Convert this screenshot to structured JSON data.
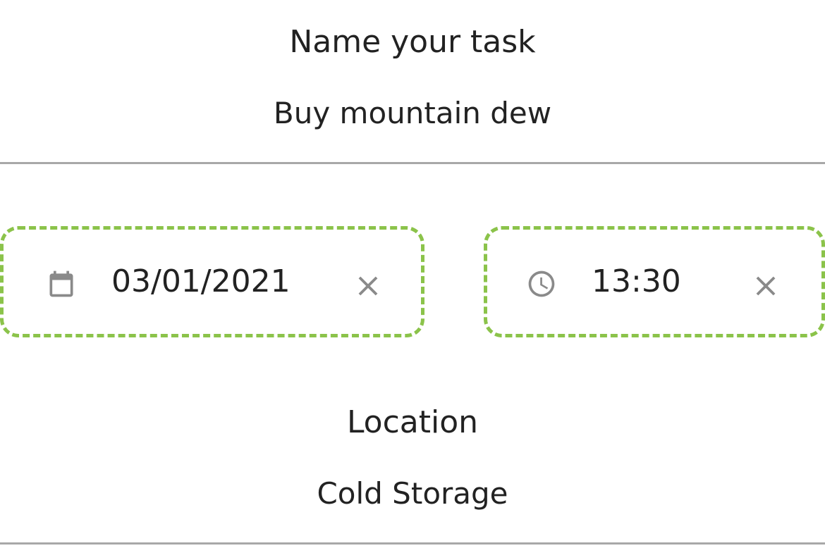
{
  "task": {
    "label": "Name your task",
    "value": "Buy mountain dew"
  },
  "date_picker": {
    "value": "03/01/2021",
    "icon": "calendar-icon",
    "clear_icon": "close-icon"
  },
  "time_picker": {
    "value": "13:30",
    "icon": "clock-icon",
    "clear_icon": "close-icon"
  },
  "location": {
    "label": "Location",
    "value": "Cold Storage"
  },
  "colors": {
    "picker_border": "#8bc34a",
    "icon": "#8a8a8a",
    "divider": "#a8a8a8",
    "text": "#222222"
  }
}
